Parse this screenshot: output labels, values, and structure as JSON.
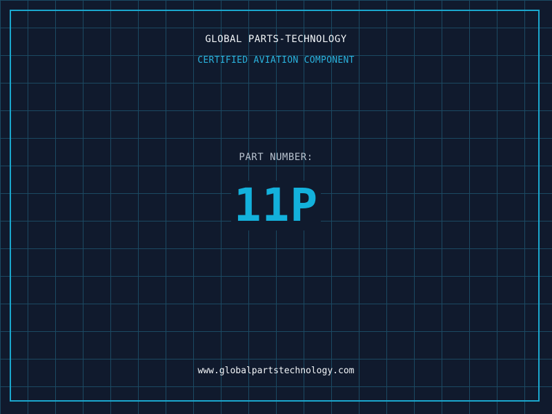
{
  "header": {
    "company": "GLOBAL PARTS-TECHNOLOGY",
    "subtitle": "CERTIFIED AVIATION COMPONENT"
  },
  "part": {
    "label": "PART NUMBER:",
    "number": "11P"
  },
  "footer": {
    "website": "www.globalpartstechnology.com"
  },
  "colors": {
    "background": "#101a2d",
    "grid": "#1b4a63",
    "accent": "#1ba8cf",
    "text": "#f2f5f8"
  }
}
